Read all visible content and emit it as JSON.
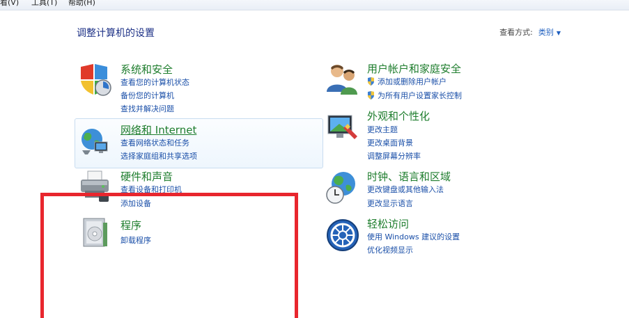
{
  "menubar": {
    "items": [
      "看(V)",
      "工具(T)",
      "帮助(H)"
    ]
  },
  "page_title": "调整计算机的设置",
  "view_by": {
    "label": "查看方式:",
    "value": "类别"
  },
  "categories": {
    "system_security": {
      "title": "系统和安全",
      "links": [
        "查看您的计算机状态",
        "备份您的计算机",
        "查找并解决问题"
      ]
    },
    "network": {
      "title": "网络和 Internet",
      "links": [
        "查看网络状态和任务",
        "选择家庭组和共享选项"
      ]
    },
    "hardware": {
      "title": "硬件和声音",
      "links": [
        "查看设备和打印机",
        "添加设备"
      ]
    },
    "programs": {
      "title": "程序",
      "links": [
        "卸载程序"
      ]
    },
    "user_accounts": {
      "title": "用户帐户和家庭安全",
      "links": [
        "添加或删除用户帐户",
        "为所有用户设置家长控制"
      ]
    },
    "appearance": {
      "title": "外观和个性化",
      "links": [
        "更改主题",
        "更改桌面背景",
        "调整屏幕分辨率"
      ]
    },
    "clock_region": {
      "title": "时钟、语言和区域",
      "links": [
        "更改键盘或其他输入法",
        "更改显示语言"
      ]
    },
    "ease_of_access": {
      "title": "轻松访问",
      "links": [
        "使用 Windows 建议的设置",
        "优化视频显示"
      ]
    }
  },
  "colors": {
    "title_green": "#1e7d2d",
    "link_blue": "#1a4fa8",
    "highlight_red": "#e8262e"
  }
}
